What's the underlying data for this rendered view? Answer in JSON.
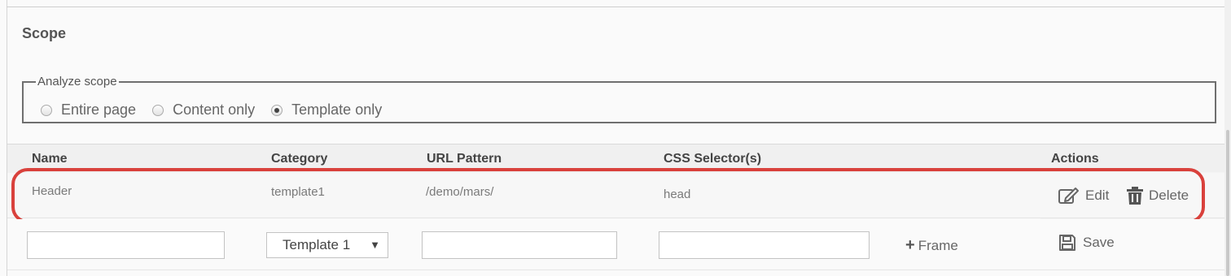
{
  "scope": {
    "title": "Scope",
    "legend": "Analyze scope",
    "options": [
      {
        "label": "Entire page",
        "checked": false
      },
      {
        "label": "Content only",
        "checked": false
      },
      {
        "label": "Template only",
        "checked": true
      }
    ]
  },
  "table": {
    "columns": [
      "Name",
      "Category",
      "URL Pattern",
      "CSS Selector(s)",
      "Actions"
    ],
    "rows": [
      {
        "name": "Header",
        "category": "template1",
        "url_pattern": "/demo/mars/",
        "css_selector": "head",
        "edit_label": "Edit",
        "delete_label": "Delete"
      }
    ],
    "new_row": {
      "name_value": "",
      "category_selected": "Template 1",
      "url_pattern_value": "",
      "css_selector_value": "",
      "frame_label": "Frame",
      "save_label": "Save"
    }
  },
  "colors": {
    "highlight": "#d9413c",
    "header_bg": "#f0f0f0"
  }
}
